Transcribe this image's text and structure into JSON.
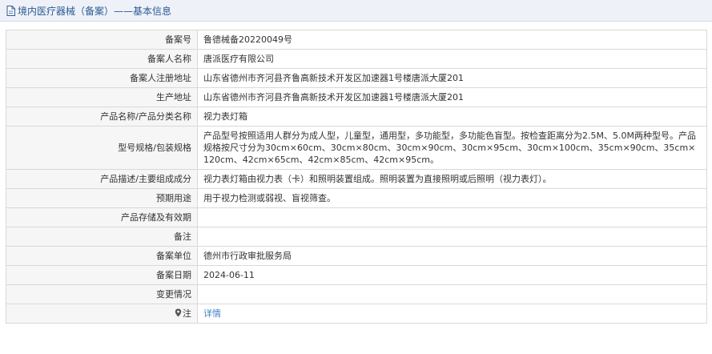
{
  "header": {
    "title": "境内医疗器械（备案）——基本信息"
  },
  "rows": [
    {
      "label": "备案号",
      "value": "鲁德械备20220049号"
    },
    {
      "label": "备案人名称",
      "value": "唐派医疗有限公司"
    },
    {
      "label": "备案人注册地址",
      "value": "山东省德州市齐河县齐鲁高新技术开发区加速器1号楼唐派大厦201"
    },
    {
      "label": "生产地址",
      "value": "山东省德州市齐河县齐鲁高新技术开发区加速器1号楼唐派大厦201"
    },
    {
      "label": "产品名称/产品分类名称",
      "value": "视力表灯箱"
    },
    {
      "label": "型号规格/包装规格",
      "value": "产品型号按照适用人群分为成人型，儿童型，通用型，多功能型，多功能色盲型。按检查距离分为2.5M、5.0M两种型号。产品规格按尺寸分为30cm×60cm、30cm×80cm、30cm×90cm、30cm×95cm、30cm×100cm、35cm×90cm、35cm×120cm、42cm×65cm、42cm×85cm、42cm×95cm。"
    },
    {
      "label": "产品描述/主要组成成分",
      "value": "视力表灯箱由视力表（卡）和照明装置组成。照明装置为直接照明或后照明（视力表灯）。"
    },
    {
      "label": "预期用途",
      "value": "用于视力检测或弱视、盲视筛查。"
    },
    {
      "label": "产品存储及有效期",
      "value": ""
    },
    {
      "label": "备注",
      "value": ""
    },
    {
      "label": "备案单位",
      "value": "德州市行政审批服务局"
    },
    {
      "label": "备案日期",
      "value": "2024-06-11"
    },
    {
      "label": "变更情况",
      "value": ""
    },
    {
      "label": "注",
      "value": "详情"
    }
  ],
  "colors": {
    "header_bg": "#eef2f8",
    "header_text": "#2b5a92",
    "label_bg": "#f6f6f6",
    "border": "#d9d9d9",
    "link": "#3a7fc8"
  },
  "icons": {
    "header": "document-icon",
    "note": "map-pin-icon"
  }
}
